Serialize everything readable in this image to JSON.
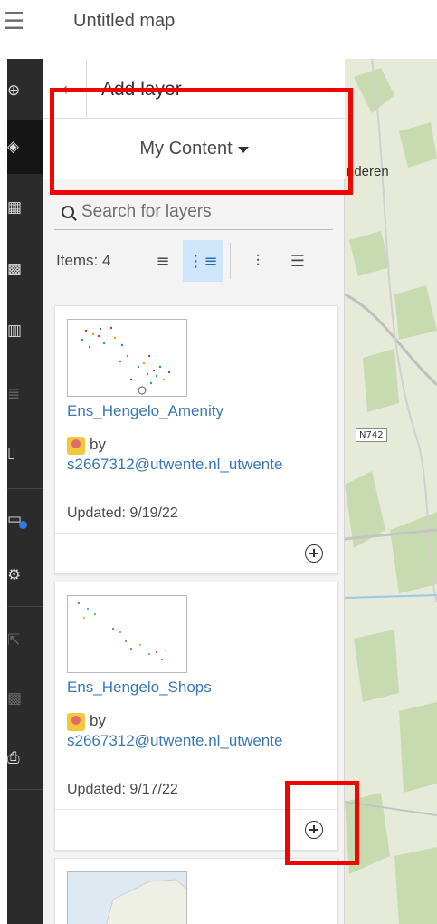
{
  "app": {
    "title": "Untitled map",
    "menu_icon": "hamburger-menu-icon"
  },
  "toolbar": {
    "items": [
      {
        "icon": "add-circle-icon",
        "state": "normal"
      },
      {
        "icon": "layers-icon",
        "state": "active"
      },
      {
        "icon": "table-icon",
        "state": "normal"
      },
      {
        "icon": "grid-icon",
        "state": "normal"
      },
      {
        "icon": "bar-chart-icon",
        "state": "normal"
      },
      {
        "icon": "legend-list-icon",
        "state": "dim"
      },
      {
        "icon": "bookmark-icon",
        "state": "normal"
      },
      {
        "icon": "basemap-icon",
        "state": "notification"
      },
      {
        "icon": "settings-gear-icon",
        "state": "normal"
      },
      {
        "icon": "share-icon",
        "state": "dim"
      },
      {
        "icon": "grid-dim-icon",
        "state": "dim"
      },
      {
        "icon": "print-icon",
        "state": "normal"
      }
    ],
    "notification_color": "#2f7ae5"
  },
  "panel": {
    "back_icon": "chevron-left-icon",
    "title": "Add layer",
    "source": {
      "label": "My Content",
      "icon": "caret-down-icon"
    },
    "search": {
      "placeholder": "Search for layers",
      "value": ""
    },
    "items_label": "Items: 4",
    "view_options": [
      "compact-list-icon",
      "list-icon",
      "filter-sliders-icon",
      "sort-icon"
    ],
    "selected_view": "list-icon"
  },
  "cards": [
    {
      "title": "Ens_Hengelo_Amenity",
      "by": "by",
      "owner": "s2667312@utwente.nl_utwente",
      "updated": "Updated: 9/19/22"
    },
    {
      "title": "Ens_Hengelo_Shops",
      "by": "by",
      "owner": "s2667312@utwente.nl_utwente",
      "updated": "Updated: 9/17/22"
    },
    {
      "title": "",
      "by": "",
      "owner": "",
      "updated": ""
    }
  ],
  "map": {
    "place_label": "nderen",
    "road_badge": "N742"
  },
  "colors": {
    "accent": "#3a77b5",
    "selected_view_bg": "#cfe6fa",
    "annotation": "#f00600",
    "toolbar_bg": "#2b2b2b"
  }
}
